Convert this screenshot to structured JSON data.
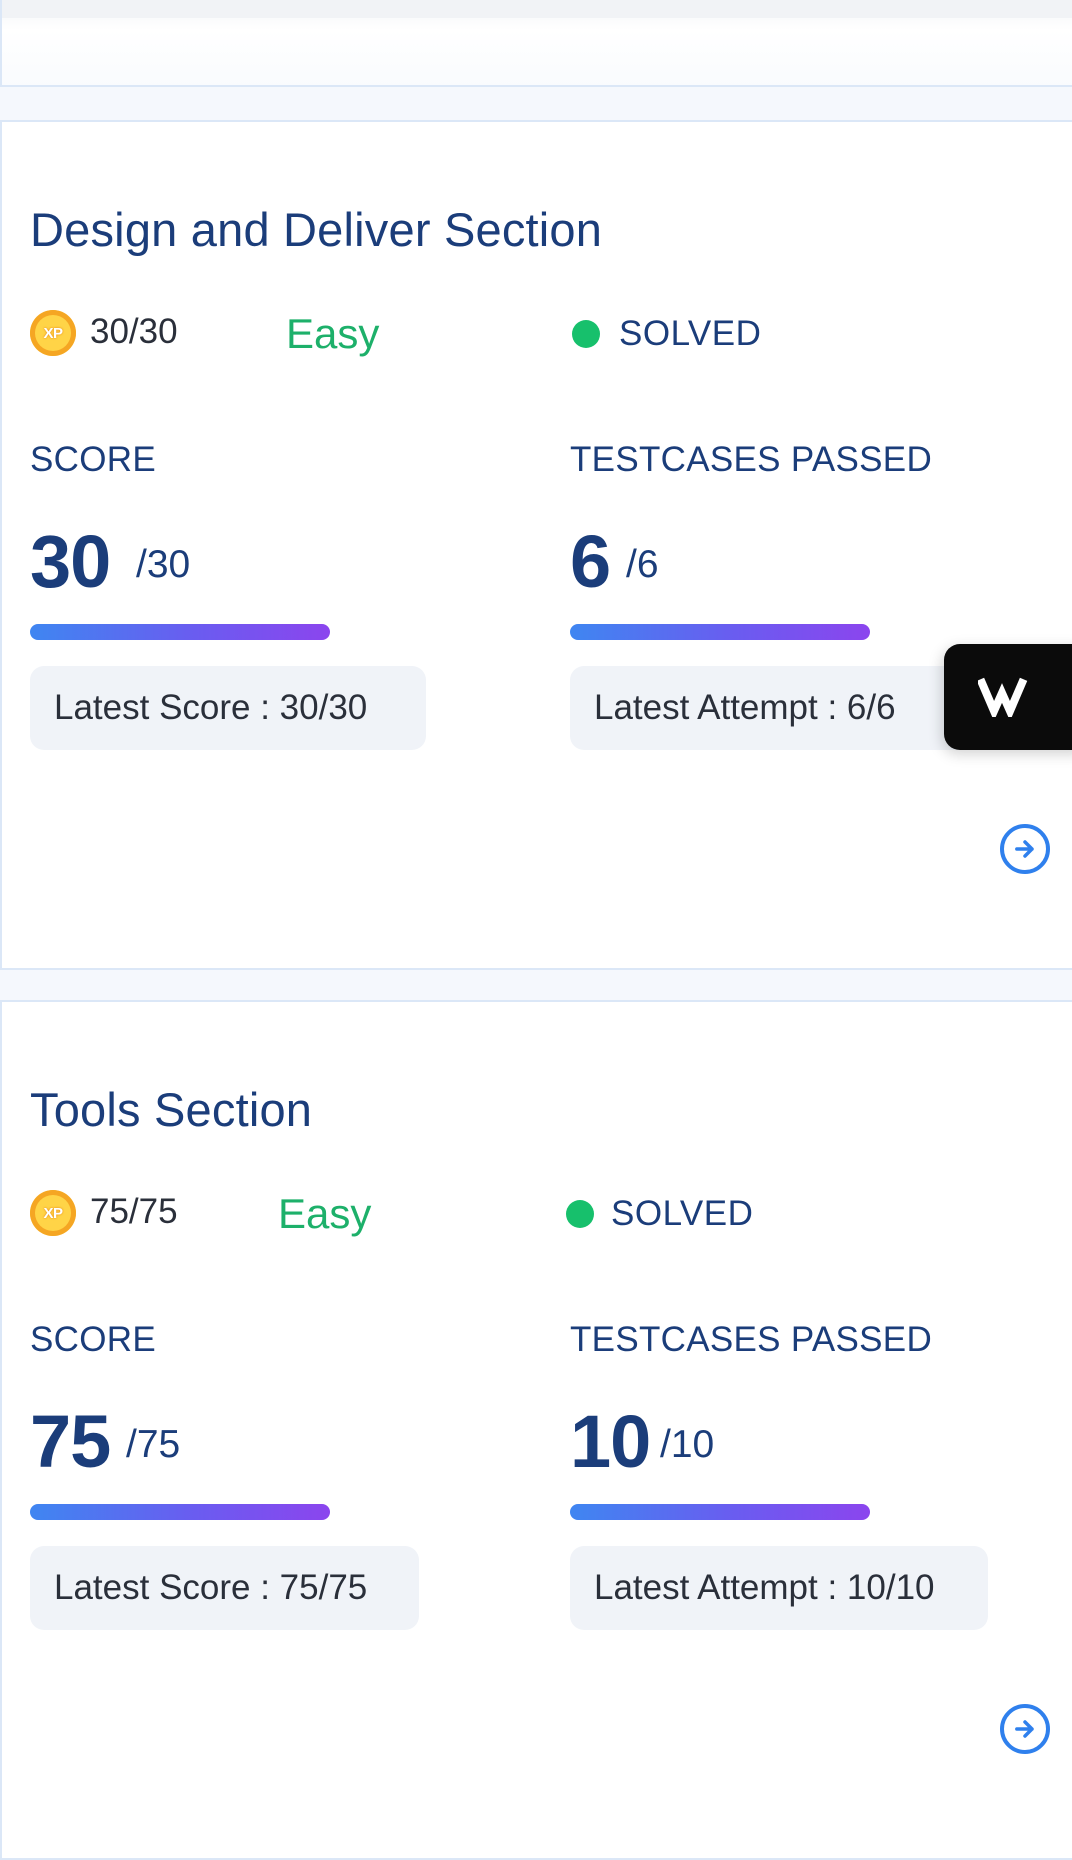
{
  "sections": [
    {
      "title": "Design and Deliver Section",
      "xp_icon_label": "XP",
      "xp": "30/30",
      "difficulty": "Easy",
      "status": "SOLVED",
      "score_label": "SCORE",
      "score": "30",
      "score_total": "/30",
      "score_progress": 1.0,
      "testcases_label": "TESTCASES PASSED",
      "testcases": "6",
      "testcases_total": "/6",
      "testcases_progress": 1.0,
      "latest_score": "Latest Score : 30/30",
      "latest_attempt": "Latest Attempt : 6/6"
    },
    {
      "title": "Tools Section",
      "xp_icon_label": "XP",
      "xp": "75/75",
      "difficulty": "Easy",
      "status": "SOLVED",
      "score_label": "SCORE",
      "score": "75",
      "score_total": "/75",
      "score_progress": 1.0,
      "testcases_label": "TESTCASES PASSED",
      "testcases": "10",
      "testcases_total": "/10",
      "testcases_progress": 1.0,
      "latest_score": "Latest Score : 75/75",
      "latest_attempt": "Latest Attempt : 10/10"
    }
  ],
  "icons": {
    "xp": "xp-coin-icon",
    "status": "status-dot-icon",
    "open": "arrow-right-circle-icon",
    "widget": "w-logo-icon"
  },
  "colors": {
    "title": "#1b3d7a",
    "difficulty_easy": "#1db06a",
    "status_solved": "#17c06c",
    "bar_start": "#3f86f1",
    "bar_end": "#8b45ee",
    "accent": "#2f80ed"
  }
}
